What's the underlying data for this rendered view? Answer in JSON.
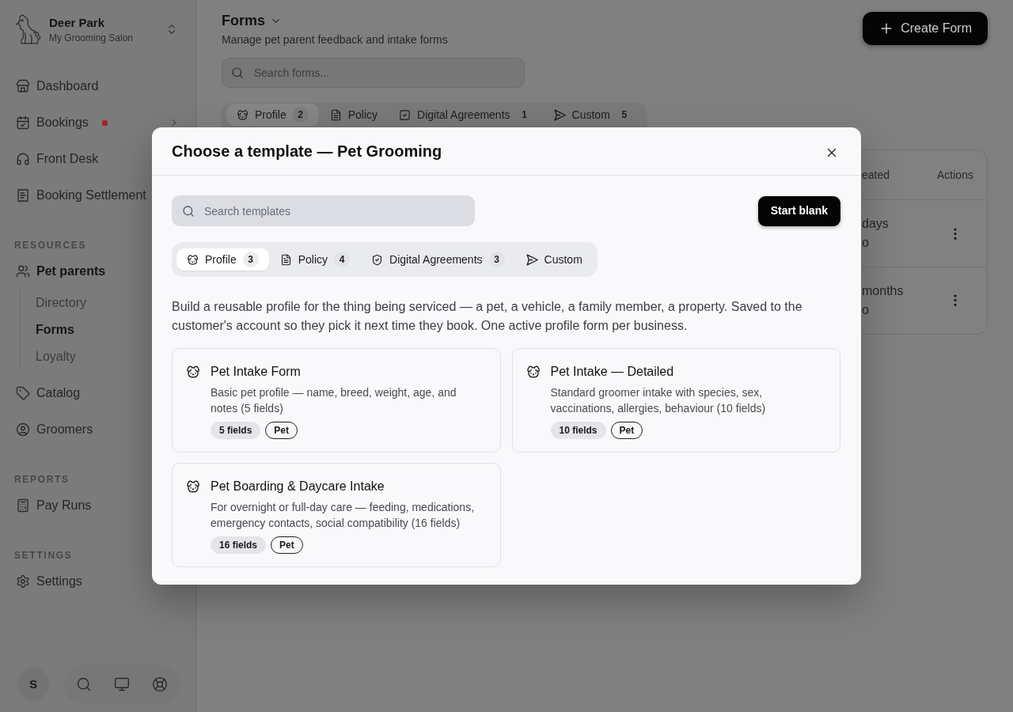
{
  "sidebar": {
    "business": {
      "name": "Deer Park",
      "subtitle": "My Grooming Salon"
    },
    "sections": [
      {
        "items": [
          {
            "label": "Dashboard",
            "selected": false
          },
          {
            "label": "Bookings",
            "selected": false,
            "alert": true,
            "expanded": false
          },
          {
            "label": "Front Desk",
            "selected": false
          },
          {
            "label": "Booking Settlement",
            "selected": false
          }
        ]
      },
      {
        "heading": "RESOURCES",
        "items": [
          {
            "label": "Pet parents",
            "selected": false,
            "expanded": true,
            "children": [
              {
                "label": "Directory",
                "selected": false
              },
              {
                "label": "Forms",
                "selected": true
              },
              {
                "label": "Loyalty",
                "selected": false
              }
            ]
          },
          {
            "label": "Catalog",
            "selected": false
          },
          {
            "label": "Groomers",
            "selected": false
          }
        ]
      },
      {
        "heading": "REPORTS",
        "items": [
          {
            "label": "Pay Runs",
            "selected": false
          }
        ]
      },
      {
        "heading": "SETTINGS",
        "items": [
          {
            "label": "Settings",
            "selected": false
          }
        ]
      }
    ],
    "user": {
      "initial": "S"
    }
  },
  "main": {
    "title": "Forms",
    "subtitle": "Manage pet parent feedback and intake forms",
    "search": {
      "placeholder": "Search forms..."
    },
    "create_button": "Create Form",
    "tabs": [
      {
        "label": "Profile",
        "count": "2",
        "selected": true
      },
      {
        "label": "Policy",
        "selected": false
      },
      {
        "label": "Digital Agreements",
        "count": "1",
        "selected": false
      },
      {
        "label": "Custom",
        "count": "5",
        "selected": false
      }
    ],
    "table": {
      "columns": [
        "eated",
        "Actions"
      ],
      "rows": [
        {
          "column_1": [
            "days",
            "o"
          ]
        },
        {
          "column_1": [
            "months",
            "o"
          ]
        }
      ]
    }
  },
  "dialog": {
    "title": "Choose a template — Pet Grooming",
    "search": {
      "placeholder": "Search templates"
    },
    "start_blank_button": "Start blank",
    "tabs": [
      {
        "label": "Profile",
        "count": "3",
        "selected": true
      },
      {
        "label": "Policy",
        "count": "4",
        "selected": false
      },
      {
        "label": "Digital Agreements",
        "count": "3",
        "selected": false
      },
      {
        "label": "Custom",
        "selected": false
      }
    ],
    "description": "Build a reusable profile for the thing being serviced — a pet, a vehicle, a family member, a property. Saved to the customer's account so they pick it next time they book. One active profile form per business.",
    "templates": [
      {
        "title": "Pet Intake Form",
        "description": "Basic pet profile — name, breed, weight, age, and notes (5 fields)",
        "badges": [
          {
            "text": "5 fields",
            "kind": "count"
          },
          {
            "text": "Pet",
            "kind": "tag"
          }
        ]
      },
      {
        "title": "Pet Intake — Detailed",
        "description": "Standard groomer intake with species, sex, vaccinations, allergies, behaviour (10 fields)",
        "badges": [
          {
            "text": "10 fields",
            "kind": "count"
          },
          {
            "text": "Pet",
            "kind": "tag"
          }
        ]
      },
      {
        "title": "Pet Boarding & Daycare Intake",
        "description": "For overnight or full-day care — feeding, medications, emergency contacts, social compatibility (16 fields)",
        "badges": [
          {
            "text": "16 fields",
            "kind": "count"
          },
          {
            "text": "Pet",
            "kind": "tag"
          }
        ]
      }
    ]
  }
}
